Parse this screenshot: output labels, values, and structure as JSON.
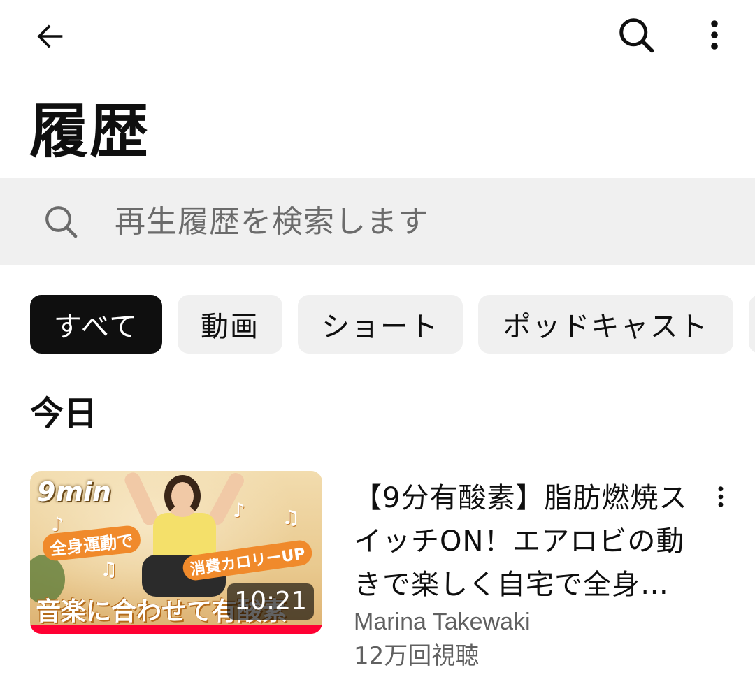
{
  "header": {
    "back_icon": "arrow-left-icon",
    "search_icon": "search-icon",
    "more_icon": "more-vert-icon"
  },
  "page": {
    "title": "履歴"
  },
  "search": {
    "placeholder": "再生履歴を検索します",
    "value": ""
  },
  "filters": {
    "chips": [
      {
        "label": "すべて",
        "active": true
      },
      {
        "label": "動画",
        "active": false
      },
      {
        "label": "ショート",
        "active": false
      },
      {
        "label": "ポッドキャスト",
        "active": false
      }
    ]
  },
  "sections": [
    {
      "title": "今日",
      "videos": [
        {
          "title": "【9分有酸素】脂肪燃焼スイッチON！エアロビの動きで楽しく自宅で全身…",
          "channel": "Marina Takewaki",
          "views": "12万回視聴",
          "duration": "10:21",
          "watched_fraction": 1.0,
          "thumbnail_text": {
            "min": "9min",
            "tag1": "全身運動で",
            "tag2": "消費カロリーUP",
            "caption": "音楽に合わせて有酸素"
          }
        }
      ]
    }
  ],
  "colors": {
    "accent_progress": "#ff0033",
    "chip_active_bg": "#0f0f0f",
    "chip_bg": "#f0f0f0",
    "search_bg": "#f0f0f0",
    "secondary_text": "#606060"
  }
}
